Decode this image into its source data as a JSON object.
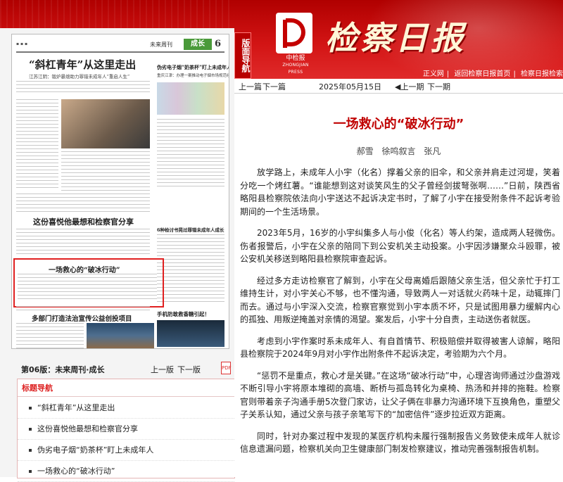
{
  "header": {
    "guide_label": "版面导航",
    "paper_title": "检察日报",
    "publisher_cn": "中检报",
    "publisher_en": "ZHONGJIAN PRESS",
    "links": [
      "正义网",
      "返回检察日报首页",
      "检察日报检索"
    ]
  },
  "newspaper_thumb": {
    "section_label": "成长",
    "page_number": "6",
    "brand": "未来周刊",
    "headline_1": "“斜杠青年”从这里走出",
    "headline_1_sub": "江苏江阴：锻炉暴熄助力罪错未成年人“重启人生”",
    "headline_2": "伪劣电子烟“奶茶杯”盯上未成年人",
    "headline_2_sub": "重庆江津：办理一案推动电子烟市场规范经营",
    "headline_3": "这份喜悦他最想和检察官分享",
    "headline_4": "6种检讨书晃过罪错未成年人成长",
    "headline_5": "一场救心的“破冰行动”",
    "headline_6": "多部门打造法治宣传公益创投项目",
    "headline_7": "手机防敢救香糖引起！"
  },
  "page_nav": {
    "page_label": "第06版：未来周刊·成长",
    "prev": "上一版",
    "next": "下一版",
    "pdf_icon": "pdf-icon"
  },
  "title_nav": {
    "heading": "标题导航",
    "items": [
      "“斜杠青年”从这里走出",
      "这份喜悦他最想和检察官分享",
      "伪劣电子烟“奶茶杯”盯上未成年人",
      "一场救心的“破冰行动”"
    ]
  },
  "article_nav": {
    "prev_article": "上一篇",
    "next_article": "下一篇",
    "date": "2025年05月15日",
    "prev_issue": "上一期",
    "next_issue": "下一期"
  },
  "article": {
    "title": "一场救心的“破冰行动”",
    "authors": "郝雪 徐鸣叙言 张凡",
    "paragraphs": [
      "放学路上，未成年人小宇（化名）撑着父亲的旧伞，和父亲并肩走过河堤，笑着分吃一个烤红薯。“谁能想到这对谈笑风生的父子曾经剑拔弩张啊……”日前，陕西省略阳县检察院依法向小宇送达不起诉决定书时，了解了小宇在接受附条件不起诉考验期间的一个生活场景。",
      "2023年5月，16岁的小宇纠集多人与小俊（化名）等人约架，造成两人轻微伤。伤者报警后，小宇在父亲的陪同下到公安机关主动投案。小宇因涉嫌聚众斗殴罪，被公安机关移送到略阳县检察院审查起诉。",
      "经过多方走访检察官了解到，小宇在父母离婚后跟随父亲生活，但父亲忙于打工维持生计，对小宇关心不够，也不懂沟通，导致两人一对话就火药味十足，动辄摔门而去。通过与小宇深入交流，检察官察觉到小宇本质不坏，只是试图用暴力缓解内心的孤独、用叛逆掩盖对亲情的渴望。案发后，小宇十分自责，主动送伤者就医。",
      "考虑到小宇作案时系未成年人、有自首情节、积极赔偿并取得被害人谅解，略阳县检察院于2024年9月对小宇作出附条件不起诉决定，考验期为六个月。",
      "“惩罚不是重点，救心才是关键。”在这场“破冰行动”中，心理咨询师通过沙盘游戏不断引导小宇将原本堆砌的高墙、断桥与孤岛转化为桌椅、热汤和并排的拖鞋。检察官则带着亲子沟通手册5次登门家访，让父子俩在非暴力沟通环境下互换角色，重塑父子关系认知，通过父亲与孩子亲笔写下的“加密信件”逐步拉近双方距离。",
      "同时，针对办案过程中发现的某医疗机构未履行强制报告义务致使未成年人就诊信息遗漏问题，检察机关向卫生健康部门制发检察建议，推动完善强制报告机制。"
    ]
  },
  "colors": {
    "brand_red": "#c00000",
    "nav_red": "#d22222",
    "section_green": "#4a9a3a"
  }
}
